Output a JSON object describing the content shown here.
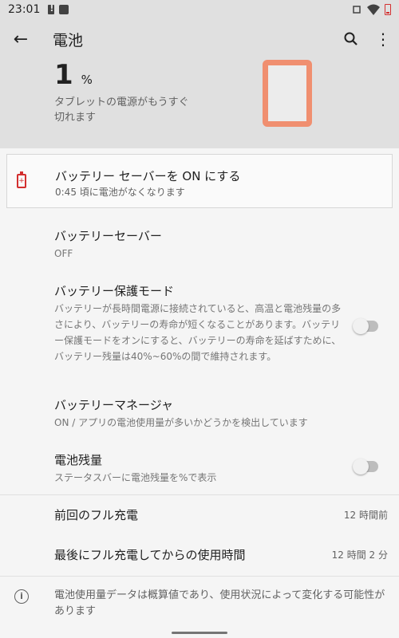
{
  "status_bar": {
    "time": "23:01"
  },
  "app_bar": {
    "title": "電池"
  },
  "header": {
    "percent": "1",
    "percent_unit": "%",
    "summary": "タブレットの電源がもうすぐ切れます",
    "battery_color": "#f08f70"
  },
  "saver_card": {
    "title": "バッテリー セーバーを ON にする",
    "subtitle": "0:45 頃に電池がなくなります",
    "icon": "battery-alert-icon",
    "accent": "#d32f2f"
  },
  "settings": [
    {
      "title": "バッテリーセーバー",
      "subtitle": "OFF"
    },
    {
      "title": "バッテリー保護モード",
      "subtitle": "バッテリーが長時間電源に接続されていると、高温と電池残量の多さにより、バッテリーの寿命が短くなることがあります。バッテリー保護モードをオンにすると、バッテリーの寿命を延ばすために、バッテリー残量は40%~60%の間で維持されます。",
      "toggle": "off"
    },
    {
      "title": "バッテリーマネージャ",
      "subtitle": "ON / アプリの電池使用量が多いかどうかを検出しています"
    },
    {
      "title": "電池残量",
      "subtitle": "ステータスバーに電池残量を%で表示",
      "toggle": "off"
    }
  ],
  "usage": [
    {
      "label": "前回のフル充電",
      "value": "12 時間前"
    },
    {
      "label": "最後にフル充電してからの使用時間",
      "value": "12 時間 2 分"
    }
  ],
  "footer": {
    "note": "電池使用量データは概算値であり、使用状況によって変化する可能性があります"
  }
}
